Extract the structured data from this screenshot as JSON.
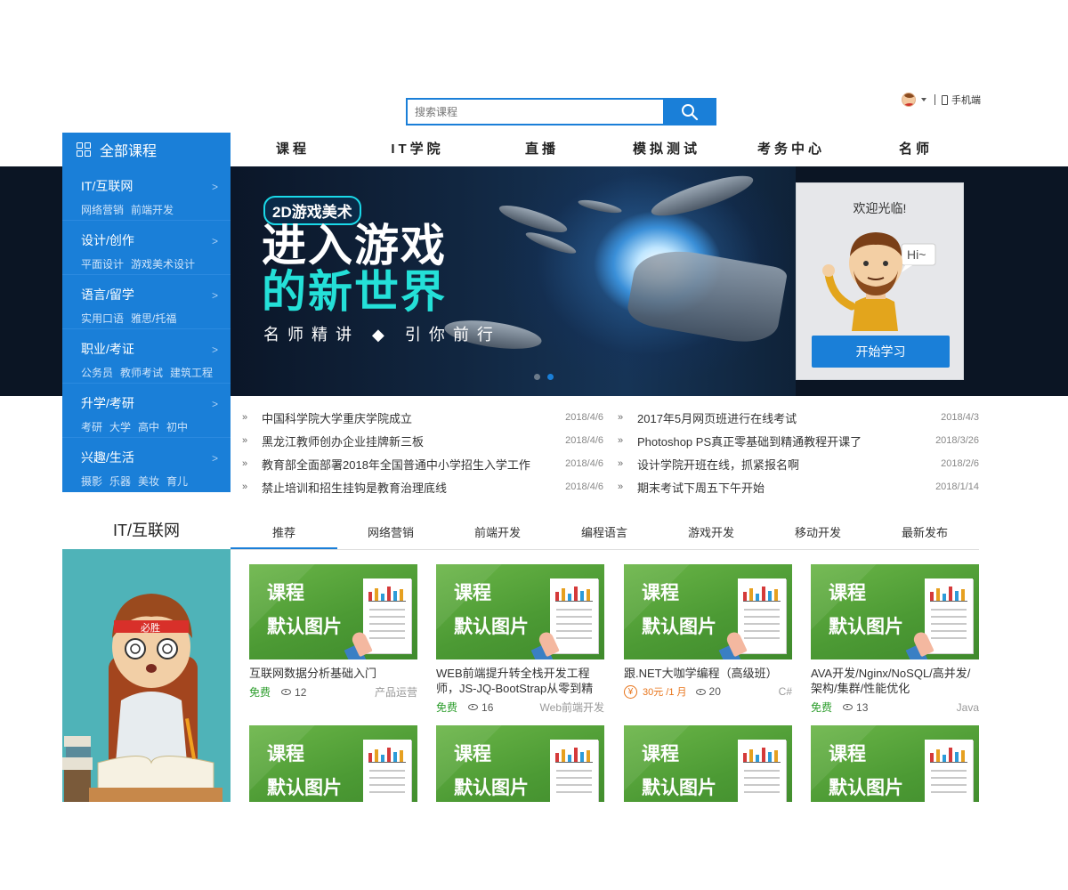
{
  "header": {
    "search_placeholder": "搜索课程",
    "mobile_label": "手机端"
  },
  "nav": {
    "all_courses": "全部课程",
    "items": [
      "课程",
      "IT学院",
      "直播",
      "模拟测试",
      "考务中心",
      "名师"
    ]
  },
  "sidebar": {
    "categories": [
      {
        "title": "IT/互联网",
        "subs": [
          "网络营销",
          "前端开发"
        ]
      },
      {
        "title": "设计/创作",
        "subs": [
          "平面设计",
          "游戏美术设计"
        ]
      },
      {
        "title": "语言/留学",
        "subs": [
          "实用口语",
          "雅思/托福"
        ]
      },
      {
        "title": "职业/考证",
        "subs": [
          "公务员",
          "教师考试",
          "建筑工程"
        ]
      },
      {
        "title": "升学/考研",
        "subs": [
          "考研",
          "大学",
          "高中",
          "初中"
        ]
      },
      {
        "title": "兴趣/生活",
        "subs": [
          "摄影",
          "乐器",
          "美妆",
          "育儿"
        ]
      }
    ],
    "arrow": ">"
  },
  "banner": {
    "badge": "2D游戏美术",
    "title_line1": "进入游戏",
    "title_line2": "的新世界",
    "subtitle": "名师精讲 ◆ 引你前行",
    "slide_count": 2,
    "active_slide": 2
  },
  "welcome": {
    "greeting": "欢迎光临!",
    "speech": "Hi~",
    "button": "开始学习"
  },
  "news": {
    "left": [
      {
        "title": "中国科学院大学重庆学院成立",
        "date": "2018/4/6"
      },
      {
        "title": "黑龙江教师创办企业挂牌新三板",
        "date": "2018/4/6"
      },
      {
        "title": "教育部全面部署2018年全国普通中小学招生入学工作",
        "date": "2018/4/6"
      },
      {
        "title": "禁止培训和招生挂钩是教育治理底线",
        "date": "2018/4/6"
      }
    ],
    "right": [
      {
        "title": "2017年5月网页班进行在线考试",
        "date": "2018/4/3"
      },
      {
        "title": "Photoshop PS真正零基础到精通教程开课了",
        "date": "2018/3/26"
      },
      {
        "title": "设计学院开班在线，抓紧报名啊",
        "date": "2018/2/6"
      },
      {
        "title": "期末考试下周五下午开始",
        "date": "2018/1/14"
      }
    ],
    "bullet": "»"
  },
  "section": {
    "title": "IT/互联网",
    "tabs": [
      "推荐",
      "网络营销",
      "前端开发",
      "编程语言",
      "游戏开发",
      "移动开发",
      "最新发布"
    ],
    "active_tab": "推荐",
    "illustration_headband": "必胜"
  },
  "courses": {
    "thumb_line1": "课程",
    "thumb_line2": "默认图片",
    "free_label": "免费",
    "items": [
      {
        "title": "互联网数据分析基础入门",
        "price": "免费",
        "views": "12",
        "category": "产品运营"
      },
      {
        "title": "WEB前端提升转全栈开发工程师，JS-JQ-BootStrap从零到精",
        "price": "免费",
        "views": "16",
        "category": "Web前端开发"
      },
      {
        "title": "跟.NET大咖学编程（高级班）",
        "price": "30元 /1 月",
        "views": "20",
        "category": "C#"
      },
      {
        "title": "AVA开发/Nginx/NoSQL/高并发/架构/集群/性能优化",
        "price": "免费",
        "views": "13",
        "category": "Java"
      }
    ],
    "second_row_count": 4
  },
  "colors": {
    "primary": "#1a7fd8",
    "banner_bg": "#0b1524",
    "free_green": "#2c9d2c",
    "price_orange": "#e8741a",
    "thumb_green": "#55a83a",
    "illus_teal": "#4fb3b8"
  }
}
